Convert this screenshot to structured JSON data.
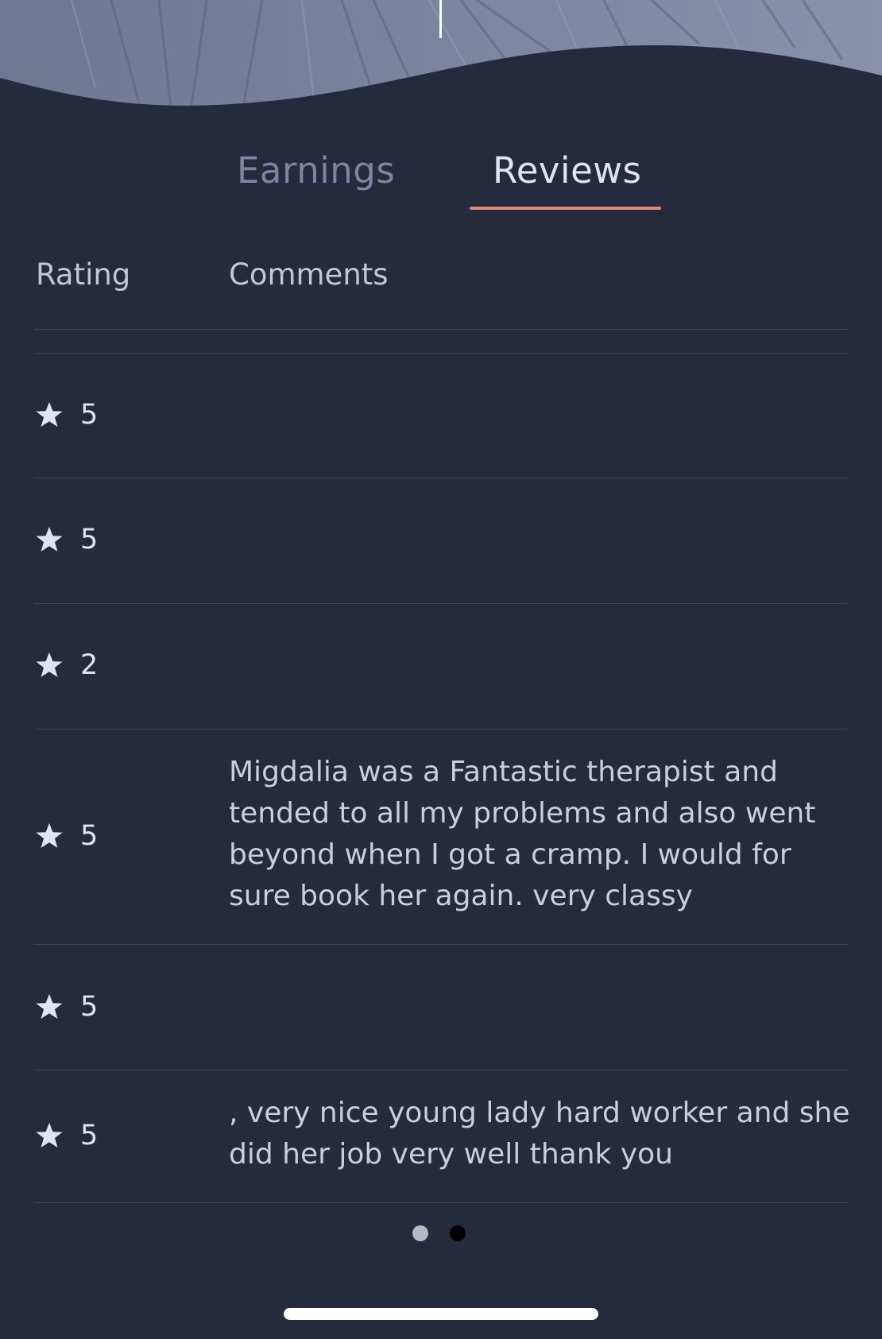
{
  "tabs": [
    {
      "label": "Earnings",
      "selected": false
    },
    {
      "label": "Reviews",
      "selected": true
    }
  ],
  "table": {
    "headers": {
      "rating": "Rating",
      "comments": "Comments"
    },
    "rows": [
      {
        "rating": "5",
        "comment": ""
      },
      {
        "rating": "5",
        "comment": ""
      },
      {
        "rating": "2",
        "comment": ""
      },
      {
        "rating": "5",
        "comment": "Migdalia was a Fantastic therapist and tended to all my problems and also went beyond when I got a cramp. I would for sure book her again. very classy"
      },
      {
        "rating": "5",
        "comment": ""
      },
      {
        "rating": "5",
        "comment": ", very nice young lady hard worker and she did her job very well thank you"
      }
    ]
  },
  "pager": {
    "pages": 2,
    "current_page": 2
  },
  "icons": {
    "rating": "star-icon"
  },
  "colors": {
    "background": "#252a3d",
    "tab_active_underline": "#e08a77",
    "tab_active_text": "#dfe3f8",
    "tab_inactive_text": "#7e84a3",
    "star": "#dfe3f8"
  }
}
